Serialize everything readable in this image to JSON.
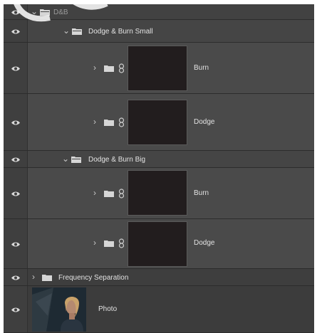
{
  "layers": {
    "dnb_group": {
      "label": "D&B"
    },
    "dodge_burn_small": {
      "label": "Dodge & Burn Small"
    },
    "small_burn": {
      "label": "Burn"
    },
    "small_dodge": {
      "label": "Dodge"
    },
    "dodge_burn_big": {
      "label": "Dodge & Burn Big"
    },
    "big_burn": {
      "label": "Burn"
    },
    "big_dodge": {
      "label": "Dodge"
    },
    "frequency_separation": {
      "label": "Frequency Separation"
    },
    "photo": {
      "label": "Photo"
    }
  },
  "icons": {
    "visibility": "eye-icon",
    "expand_open": "chevron-down-icon",
    "expand_closed": "chevron-right-icon",
    "group": "folder-icon",
    "mask_link": "chain-link-icon"
  },
  "colors": {
    "panel_bg": "#3b3b3b",
    "row_bg": "#4a4a4a",
    "mask_fill": "#221d1e",
    "text": "#e2e2e2"
  }
}
